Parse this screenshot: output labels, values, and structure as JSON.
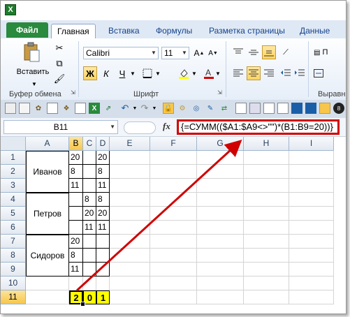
{
  "app": {
    "logo_letter": "X"
  },
  "tabs": [
    {
      "label": "Файл"
    },
    {
      "label": "Главная"
    },
    {
      "label": "Вставка"
    },
    {
      "label": "Формулы"
    },
    {
      "label": "Разметка страницы"
    },
    {
      "label": "Данные"
    }
  ],
  "ribbon": {
    "clipboard": {
      "paste_label": "Вставить",
      "group_label": "Буфер обмена"
    },
    "font": {
      "font_name": "Calibri",
      "font_size": "11",
      "group_label": "Шрифт",
      "bold": "Ж",
      "italic": "К",
      "underline": "Ч"
    },
    "alignment": {
      "group_label": "Выравн",
      "wrap_label": "П"
    }
  },
  "formula_bar": {
    "name_box": "B11",
    "fx": "fx",
    "formula": "{=СУММ(($A1:$A9<>\"\")*(B1:B9=20))}"
  },
  "columns": [
    "A",
    "B",
    "C",
    "D",
    "E",
    "F",
    "G",
    "H",
    "I"
  ],
  "rows": [
    "1",
    "2",
    "3",
    "4",
    "5",
    "6",
    "7",
    "8",
    "9",
    "10",
    "11"
  ],
  "names": [
    "Иванов",
    "Петров",
    "Сидоров"
  ],
  "cells": {
    "B1": "20",
    "D1": "20",
    "B2": "8",
    "D2": "8",
    "B3": "11",
    "D3": "11",
    "C4": "8",
    "D4": "8",
    "C5": "20",
    "D5": "20",
    "C6": "11",
    "D6": "11",
    "B7": "20",
    "B8": "8",
    "B9": "11",
    "B11": "2",
    "C11": "0",
    "D11": "1"
  },
  "colors": {
    "highlight": "#ffff00",
    "callout": "#d00000",
    "file_tab": "#2a8a3e"
  }
}
